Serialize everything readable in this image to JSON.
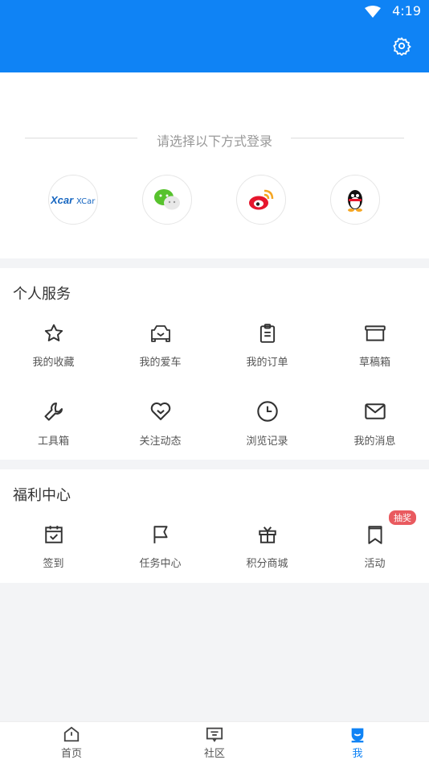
{
  "status": {
    "time": "4:19"
  },
  "login": {
    "title": "请选择以下方式登录",
    "providers": [
      {
        "name": "xcar-icon",
        "label": "XCar爱卡"
      },
      {
        "name": "wechat-icon"
      },
      {
        "name": "weibo-icon"
      },
      {
        "name": "qq-icon"
      }
    ]
  },
  "personal": {
    "title": "个人服务",
    "items": [
      {
        "label": "我的收藏",
        "icon": "star-icon"
      },
      {
        "label": "我的爱车",
        "icon": "car-icon"
      },
      {
        "label": "我的订单",
        "icon": "clipboard-icon"
      },
      {
        "label": "草稿箱",
        "icon": "drawer-icon"
      },
      {
        "label": "工具箱",
        "icon": "wrench-icon"
      },
      {
        "label": "关注动态",
        "icon": "heart-icon"
      },
      {
        "label": "浏览记录",
        "icon": "clock-icon"
      },
      {
        "label": "我的消息",
        "icon": "mail-icon"
      }
    ]
  },
  "welfare": {
    "title": "福利中心",
    "badge": "抽奖",
    "items": [
      {
        "label": "签到",
        "icon": "calendar-check-icon"
      },
      {
        "label": "任务中心",
        "icon": "flag-icon"
      },
      {
        "label": "积分商城",
        "icon": "gift-icon"
      },
      {
        "label": "活动",
        "icon": "bookmark-icon"
      }
    ]
  },
  "tabs": [
    {
      "label": "首页",
      "icon": "home-icon"
    },
    {
      "label": "社区",
      "icon": "community-icon"
    },
    {
      "label": "我",
      "icon": "profile-icon",
      "active": true
    }
  ],
  "colors": {
    "accent": "#0f83f5",
    "badge": "#e95a5f"
  }
}
